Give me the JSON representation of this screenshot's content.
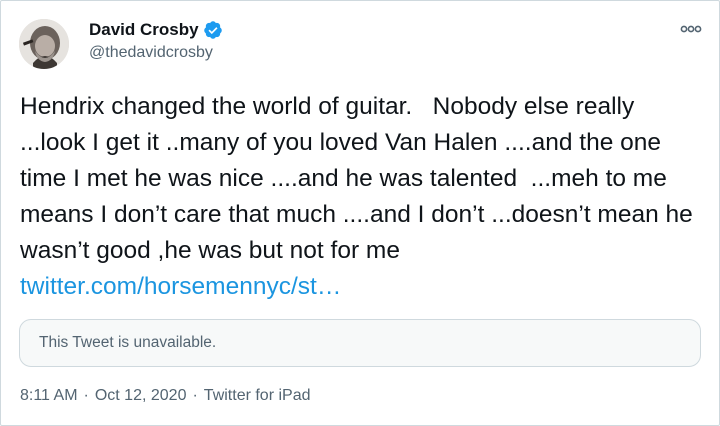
{
  "author": {
    "display_name": "David Crosby",
    "handle": "@thedavidcrosby",
    "verified": true,
    "avatar_icon": "profile-photo-icon"
  },
  "tweet": {
    "text": "Hendrix changed the world of guitar.   Nobody else really ...look I get it ..many of you loved Van Halen ....and the one time I met he was nice ....and he was talented  ...meh to me means I don’t care that much ....and I don’t ...doesn’t mean he wasn’t good ,he was but not for me ",
    "link_text": "twitter.com/horsemennyc/st…",
    "quoted_unavailable": "This Tweet is unavailable."
  },
  "meta": {
    "time": "8:11 AM",
    "separator": "·",
    "date": "Oct 12, 2020",
    "source": "Twitter for iPad"
  },
  "colors": {
    "link": "#1b95e0",
    "verified": "#1d9bf0",
    "secondary_text": "#536471",
    "border": "#cfd9de"
  }
}
